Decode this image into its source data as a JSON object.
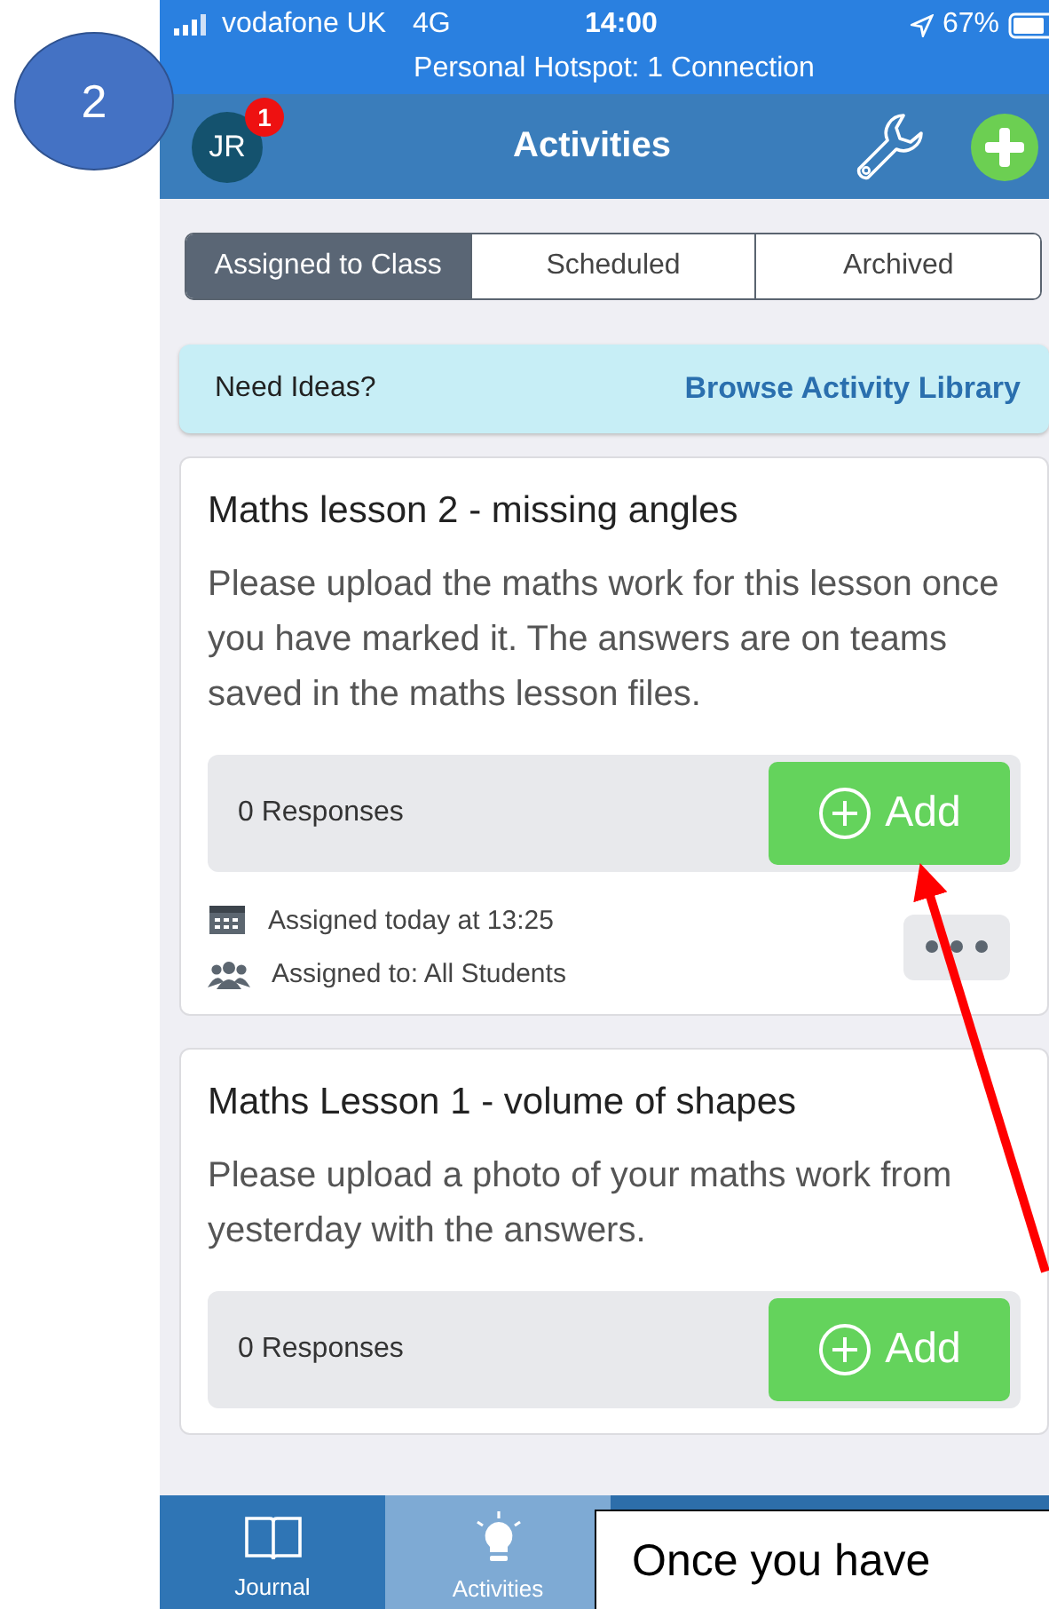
{
  "annotation_marker": "2",
  "status_bar": {
    "carrier": "vodafone UK",
    "network": "4G",
    "time": "14:00",
    "battery": "67%",
    "hotspot": "Personal Hotspot: 1 Connection"
  },
  "header": {
    "avatar": "JR",
    "badge": "1",
    "title": "Activities"
  },
  "segments": [
    {
      "label": "Assigned to Class",
      "selected": true
    },
    {
      "label": "Scheduled",
      "selected": false
    },
    {
      "label": "Archived",
      "selected": false
    }
  ],
  "ideas": {
    "label": "Need Ideas?",
    "link": "Browse Activity Library"
  },
  "activities": [
    {
      "title": "Maths lesson 2 - missing angles",
      "description": "Please upload the maths work for this lesson once you have marked it. The answers are on teams saved in the maths lesson files.",
      "responses": "0 Responses",
      "add": "Add",
      "assigned_date": "Assigned today at 13:25",
      "assigned_to": "Assigned to: All Students"
    },
    {
      "title": "Maths Lesson 1 - volume of shapes",
      "description": "Please upload a photo of your maths work from yesterday with the answers.",
      "responses": "0 Responses",
      "add": "Add"
    }
  ],
  "bottom_tabs": [
    {
      "label": "Journal",
      "selected": false
    },
    {
      "label": "Activities",
      "selected": true
    }
  ],
  "callout": "Once you have"
}
